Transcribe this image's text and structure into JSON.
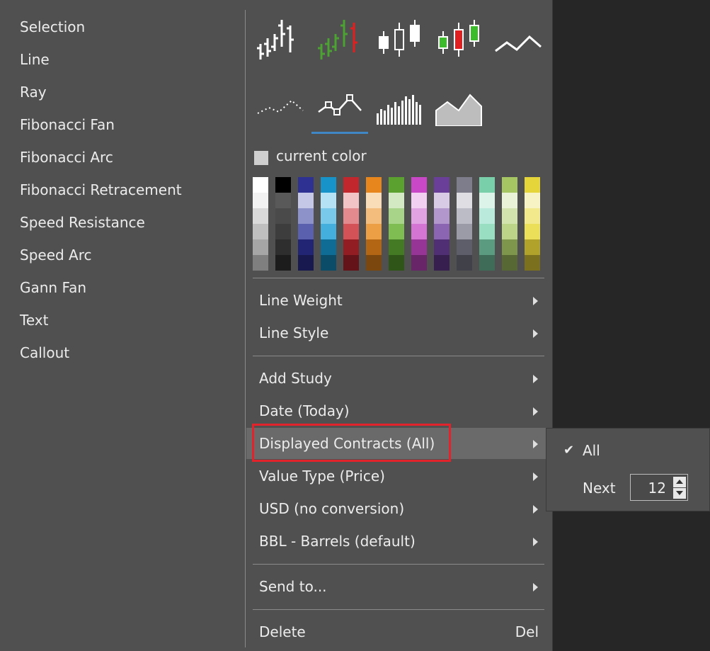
{
  "tools": [
    "Selection",
    "Line",
    "Ray",
    "Fibonacci Fan",
    "Fibonacci Arc",
    "Fibonacci Retracement",
    "Speed Resistance",
    "Speed Arc",
    "Gann Fan",
    "Text",
    "Callout"
  ],
  "chart_icons": [
    "ohlc-bars-icon",
    "ohlc-colored-bars-icon",
    "candlestick-icon",
    "candlestick-colored-icon",
    "line-chart-icon",
    "dotted-line-chart-icon",
    "line-with-markers-icon",
    "histogram-icon",
    "area-chart-icon"
  ],
  "current_color_label": "current color",
  "palette": [
    [
      "#ffffff",
      "#f2f2f2",
      "#d9d9d9",
      "#bfbfbf",
      "#a6a6a6",
      "#7f7f7f"
    ],
    [
      "#000000",
      "#595959",
      "#4a4a4a",
      "#3d3d3d",
      "#2e2e2e",
      "#1c1c1c"
    ],
    [
      "#2e3192",
      "#c5c8e6",
      "#8d92c8",
      "#5a60ad",
      "#222573",
      "#18194f"
    ],
    [
      "#1793c9",
      "#b5e2f5",
      "#79c9ea",
      "#44afdc",
      "#0f6d95",
      "#0b4c68"
    ],
    [
      "#c1272d",
      "#f2c4c6",
      "#e38a8e",
      "#d25257",
      "#921d22",
      "#641418"
    ],
    [
      "#e8861e",
      "#f9dcb8",
      "#f2bd7d",
      "#ec9f44",
      "#b36715",
      "#7c470f"
    ],
    [
      "#5aa12f",
      "#d2e9c3",
      "#a8d489",
      "#7fbd52",
      "#447a23",
      "#2f5518"
    ],
    [
      "#c848c7",
      "#f1d0f1",
      "#e2a3e2",
      "#d475d3",
      "#963596",
      "#682568"
    ],
    [
      "#6a3f99",
      "#d8cbe6",
      "#b197cc",
      "#8b65b2",
      "#502f74",
      "#372050"
    ],
    [
      "#7d7d8c",
      "#dedee3",
      "#bcbcc6",
      "#9b9ba8",
      "#5e5e6a",
      "#41414a"
    ],
    [
      "#79cfaa",
      "#dcf3e9",
      "#baeadb",
      "#99ddc2",
      "#5b9c80",
      "#3f6c59"
    ],
    [
      "#a6c664",
      "#e9f1d6",
      "#d3e3ad",
      "#bcd487",
      "#7d964b",
      "#576834"
    ],
    [
      "#e6d53a",
      "#f8f3c4",
      "#f1e98c",
      "#ebdf5a",
      "#b0a22b",
      "#7a701e"
    ]
  ],
  "menu": {
    "line_weight": "Line Weight",
    "line_style": "Line Style",
    "add_study": "Add Study",
    "date": "Date (Today)",
    "displayed_contracts": "Displayed Contracts (All)",
    "value_type": "Value Type (Price)",
    "currency": "USD (no conversion)",
    "units": "BBL - Barrels (default)",
    "send_to": "Send to...",
    "delete": "Delete",
    "delete_shortcut": "Del"
  },
  "submenu": {
    "check": "✔",
    "all": "All",
    "next": "Next",
    "next_value": "12"
  }
}
